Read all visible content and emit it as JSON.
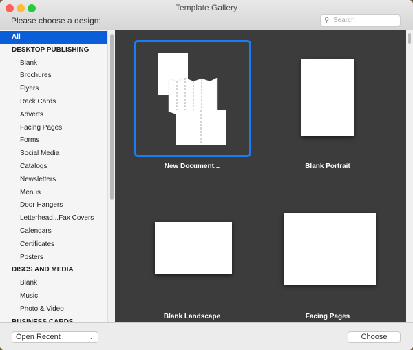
{
  "window": {
    "title": "Template Gallery",
    "prompt": "Please choose a design:"
  },
  "search": {
    "placeholder": "Search"
  },
  "sidebar": {
    "items": [
      {
        "label": "All",
        "type": "selected"
      },
      {
        "label": "DESKTOP PUBLISHING",
        "type": "header"
      },
      {
        "label": "Blank"
      },
      {
        "label": "Brochures"
      },
      {
        "label": "Flyers"
      },
      {
        "label": "Rack Cards"
      },
      {
        "label": "Adverts"
      },
      {
        "label": "Facing Pages"
      },
      {
        "label": "Forms"
      },
      {
        "label": "Social Media"
      },
      {
        "label": "Catalogs"
      },
      {
        "label": "Newsletters"
      },
      {
        "label": "Menus"
      },
      {
        "label": "Door Hangers"
      },
      {
        "label": "Letterhead...Fax Covers"
      },
      {
        "label": "Calendars"
      },
      {
        "label": "Certificates"
      },
      {
        "label": "Posters"
      },
      {
        "label": "DISCS AND MEDIA",
        "type": "header"
      },
      {
        "label": "Blank"
      },
      {
        "label": "Music"
      },
      {
        "label": "Photo & Video"
      },
      {
        "label": "BUSINESS CARDS",
        "type": "header"
      }
    ]
  },
  "templates": [
    {
      "label": "New Document...",
      "selected": true
    },
    {
      "label": "Blank Portrait"
    },
    {
      "label": "Blank Landscape"
    },
    {
      "label": "Facing Pages"
    }
  ],
  "footer": {
    "open_recent": "Open Recent",
    "choose": "Choose"
  },
  "colors": {
    "accent": "#0a5fd8",
    "selection_border": "#1a7cf5",
    "content_bg": "#3c3c3c"
  }
}
